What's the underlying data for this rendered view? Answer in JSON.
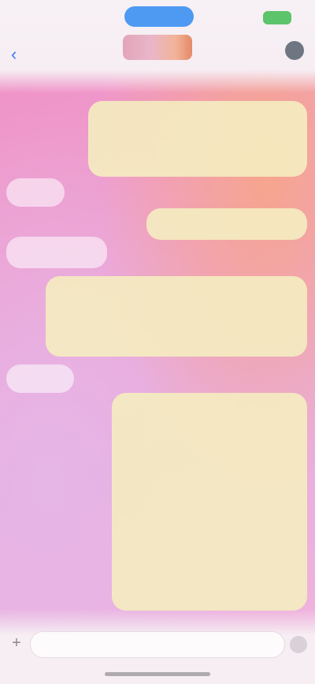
{
  "status_bar": {
    "time": "",
    "battery": ""
  },
  "header": {
    "contact_name": ""
  },
  "messages": [
    {
      "direction": "out",
      "lines": [
        "",
        ""
      ]
    },
    {
      "direction": "in",
      "lines": [
        ""
      ]
    },
    {
      "direction": "out",
      "lines": [
        ""
      ]
    },
    {
      "direction": "in",
      "lines": [
        ""
      ]
    },
    {
      "direction": "out",
      "lines": [
        "",
        ""
      ]
    },
    {
      "direction": "in",
      "lines": [
        ""
      ]
    },
    {
      "direction": "out",
      "lines": [
        "",
        ""
      ]
    }
  ],
  "composer": {
    "placeholder": ""
  },
  "colors": {
    "outgoing_bubble": "#f4ecc0",
    "incoming_bubble": "#ffffff",
    "live_pill": "#4e9af2",
    "battery": "#5cc46a",
    "accent": "#3478f6"
  },
  "icons": {
    "back": "chevron-left-icon",
    "video": "video-camera-icon",
    "plus": "plus-icon",
    "mic": "microphone-icon"
  }
}
